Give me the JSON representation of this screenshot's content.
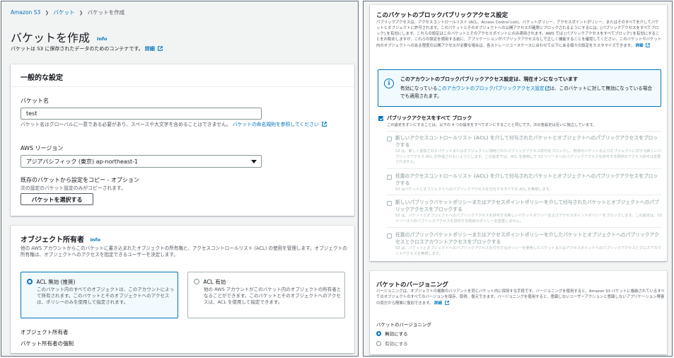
{
  "breadcrumb": {
    "items": [
      "Amazon S3",
      "バケット",
      "バケットを作成"
    ],
    "separator": "❯"
  },
  "page": {
    "title": "バケットを作成",
    "info": "Info",
    "description": "バケットは S3 に保存されたデータのためのコンテナです。",
    "details_link": "詳細"
  },
  "general": {
    "heading": "一般的な設定",
    "bucket_name_label": "バケット名",
    "bucket_name_value": "test",
    "bucket_name_hint": "バケット名はグローバルに一意である必要があり、スペースや大文字を含めることはできません。",
    "naming_rules_link": "バケットの命名規則を参照してください",
    "region_label": "AWS リージョン",
    "region_value": "アジアパシフィック (東京) ap-northeast-1",
    "copy_label": "既存のバケットから設定をコピー - オプション",
    "copy_hint": "次の設定のバケット設定のみがコピーされます。",
    "choose_bucket_button": "バケットを選択する"
  },
  "ownership": {
    "heading": "オブジェクト所有者",
    "info": "Info",
    "description": "他の AWS アカウントからこのバケットに書き込まれたオブジェクトの所有権と、アクセスコントロールリスト (ACL) の使用を管理します。オブジェクトの所有権は、オブジェクトへのアクセスを指定できるユーザーを決定します。",
    "options": [
      {
        "title": "ACL 無効 (推奨)",
        "description": "このバケット内のすべてのオブジェクトは、このアカウントによって所有されます。このバケットとそのオブジェクトへのアクセスは、ポリシーのみを使用して指定されます。",
        "selected": true
      },
      {
        "title": "ACL 有効",
        "description": "他の AWS アカウントがこのバケット内のオブジェクトの所有者となることができます。このバケットとそのオブジェクトへのアクセスは、ACL を使用して指定できます。",
        "selected": false
      }
    ],
    "owner_label": "オブジェクト所有者",
    "owner_value": "バケット所有者の強制"
  },
  "block_public": {
    "heading": "このバケットのブロックパブリックアクセス設定",
    "description": "パブリックアクセスは、アクセスコントロールリスト (ACL、Access Control List)、バケットポリシー、アクセスポイントポリシー、またはそのすべてを介してバケットとオブジェクトに許可されます。このバケットとそのオブジェクトへの公開アクセスが確実にブロックされるようにするには、[パブリックアクセスをすべてブロック] を有効にします。これらの設定はこのバケットとそのアクセスポイントにのみ適用されます。AWS では [パブリックアクセスをすべてブロック] を有効にすることをお勧めしますが、これらの設定を適用する前に、アプリケーションがパブリックアクセスなしで正しく機能することを確認してください。このバケットやバケット内のオブジェクトへのある程度の公開アクセスが必要な場合は、各ストレージユースケースに合わせて以下にある個々の設定をカスタマイズできます。",
    "details_link": "詳細",
    "alert_title": "このアカウントのブロックパブリックアクセス設定は、現在オンになっています",
    "alert_text_1": "有効になっている",
    "alert_link": "このアカウントのブロックパブリックアクセス設定",
    "alert_text_2": "は、このバケットに対して無効になっている場合でも適用されます。",
    "block_all_label": "パブリックアクセスをすべて ブロック",
    "block_all_desc": "この設定をオンにすることは、以下の 4 つの設定をすべてオンにすることと同じです。次の各設定は互いに独立しています。",
    "sub_options": [
      {
        "title": "新しいアクセスコントロールリスト (ACL) を介して付与されたバケットとオブジェクトへのパブリックアクセスをブロックする",
        "desc": "S3 は、新しく追加されたバケットまたはオブジェクトに適用されたパブリックアクセス許可をブロックし、既存のバケットおよびオブジェクトに対する新しいパブリックアクセス ACL が作成されないようにします。この設定では、ACL を使用して S3 リソースへのパブリックアクセスを許可する既存のアクセス許可は変更されません。"
      },
      {
        "title": "任意のアクセスコントロールリスト (ACL) を介して付与されたバケットとオブジェクトへのパブリックアクセスをブロックする",
        "desc": "S3 はバケットとオブジェクトへのパブリックアクセスを付与するすべての ACL を無視します。"
      },
      {
        "title": "新しいパブリックバケットポリシーまたはアクセスポイントポリシーを介して付与されたバケットとオブジェクトへのパブリックアクセスをブロックする",
        "desc": "S3 は、バケットとオブジェクトへのパブリックアクセスを許可する新しいバケットポリシーおよびアクセスポイントポリシーをブロックします。この設定は、S3 リソースへのパブリックアクセスを許可する既存のポリシーを変更しません。"
      },
      {
        "title": "任意のパブリックバケットポリシーまたはアクセスポイントポリシーを介したバケットとオブジェクトへのパブリックアクセスとクロスアカウントアクセスをブロックする",
        "desc": "S3 は、バケットとオブジェクトへのパブリックアクセスを付与するポリシーを使用したバケットまたはアクセスポイントへのパブリックアクセスとクロスアカウントアクセスを無視します。"
      }
    ]
  },
  "versioning": {
    "heading": "バケットのバージョニング",
    "description": "バージョニングは、オブジェクトの複数のバリアントを同じバケット内に保持する手段です。バージョニングを使用すると、Amazon S3 バケットに格納されているすべてのオブジェクトのすべてのバージョンを保存、取得、復元できます。バージョニングを使用すると、意図しないユーザーアクションと意図しないアプリケーション障害の両方から簡単に復旧できます。",
    "details_link": "詳細",
    "label": "バケットのバージョニング",
    "options": [
      {
        "label": "無効にする",
        "selected": true
      },
      {
        "label": "有効にする",
        "selected": false
      }
    ]
  },
  "colors": {
    "link": "#0073bb",
    "info_bg": "#f1faff",
    "text": "#16191f",
    "secondary": "#545b64"
  }
}
